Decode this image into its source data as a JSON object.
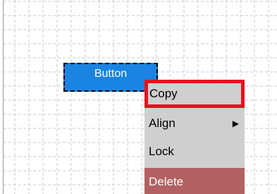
{
  "canvas": {
    "button_label": "Button"
  },
  "context_menu": {
    "items": [
      {
        "label": "Copy",
        "highlighted": true
      },
      {
        "label": "Align",
        "has_submenu": true,
        "submenu_icon": "arrow-right-icon"
      },
      {
        "label": "Lock"
      },
      {
        "label": "Delete",
        "destructive": true
      }
    ],
    "submenu_arrow": "▶"
  },
  "colors": {
    "button_fill": "#1a84e3",
    "menu_background": "#cfcfcf",
    "highlight_border": "#e8101e",
    "delete_background": "#b36062"
  }
}
